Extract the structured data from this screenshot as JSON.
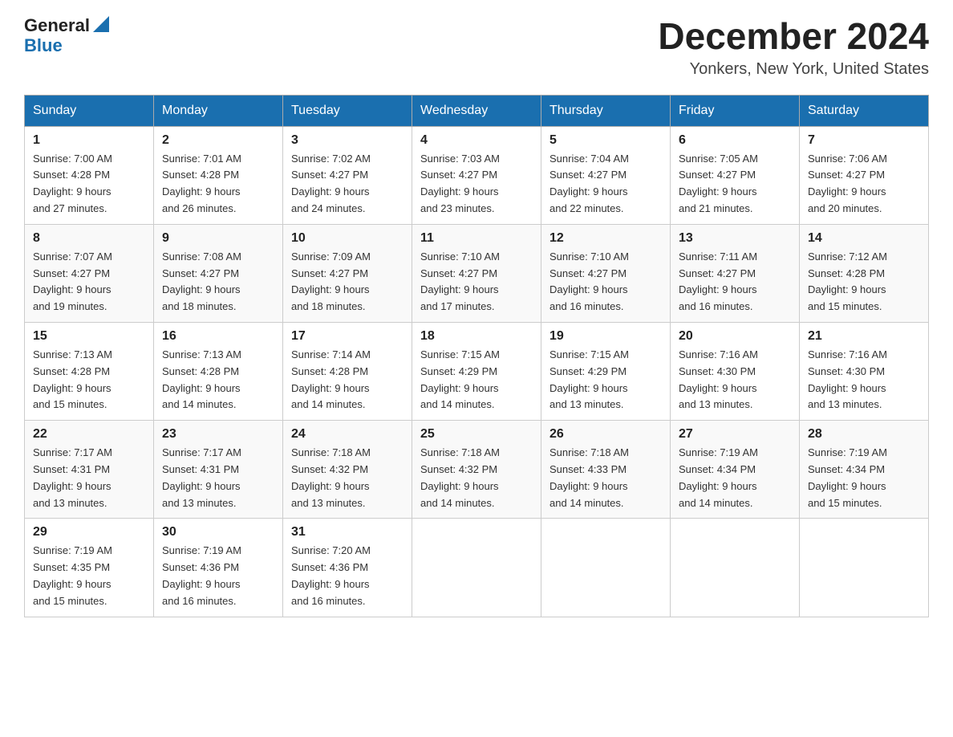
{
  "logo": {
    "general": "General",
    "blue": "Blue"
  },
  "title": "December 2024",
  "location": "Yonkers, New York, United States",
  "days_of_week": [
    "Sunday",
    "Monday",
    "Tuesday",
    "Wednesday",
    "Thursday",
    "Friday",
    "Saturday"
  ],
  "weeks": [
    [
      {
        "day": "1",
        "sunrise": "7:00 AM",
        "sunset": "4:28 PM",
        "daylight": "9 hours and 27 minutes."
      },
      {
        "day": "2",
        "sunrise": "7:01 AM",
        "sunset": "4:28 PM",
        "daylight": "9 hours and 26 minutes."
      },
      {
        "day": "3",
        "sunrise": "7:02 AM",
        "sunset": "4:27 PM",
        "daylight": "9 hours and 24 minutes."
      },
      {
        "day": "4",
        "sunrise": "7:03 AM",
        "sunset": "4:27 PM",
        "daylight": "9 hours and 23 minutes."
      },
      {
        "day": "5",
        "sunrise": "7:04 AM",
        "sunset": "4:27 PM",
        "daylight": "9 hours and 22 minutes."
      },
      {
        "day": "6",
        "sunrise": "7:05 AM",
        "sunset": "4:27 PM",
        "daylight": "9 hours and 21 minutes."
      },
      {
        "day": "7",
        "sunrise": "7:06 AM",
        "sunset": "4:27 PM",
        "daylight": "9 hours and 20 minutes."
      }
    ],
    [
      {
        "day": "8",
        "sunrise": "7:07 AM",
        "sunset": "4:27 PM",
        "daylight": "9 hours and 19 minutes."
      },
      {
        "day": "9",
        "sunrise": "7:08 AM",
        "sunset": "4:27 PM",
        "daylight": "9 hours and 18 minutes."
      },
      {
        "day": "10",
        "sunrise": "7:09 AM",
        "sunset": "4:27 PM",
        "daylight": "9 hours and 18 minutes."
      },
      {
        "day": "11",
        "sunrise": "7:10 AM",
        "sunset": "4:27 PM",
        "daylight": "9 hours and 17 minutes."
      },
      {
        "day": "12",
        "sunrise": "7:10 AM",
        "sunset": "4:27 PM",
        "daylight": "9 hours and 16 minutes."
      },
      {
        "day": "13",
        "sunrise": "7:11 AM",
        "sunset": "4:27 PM",
        "daylight": "9 hours and 16 minutes."
      },
      {
        "day": "14",
        "sunrise": "7:12 AM",
        "sunset": "4:28 PM",
        "daylight": "9 hours and 15 minutes."
      }
    ],
    [
      {
        "day": "15",
        "sunrise": "7:13 AM",
        "sunset": "4:28 PM",
        "daylight": "9 hours and 15 minutes."
      },
      {
        "day": "16",
        "sunrise": "7:13 AM",
        "sunset": "4:28 PM",
        "daylight": "9 hours and 14 minutes."
      },
      {
        "day": "17",
        "sunrise": "7:14 AM",
        "sunset": "4:28 PM",
        "daylight": "9 hours and 14 minutes."
      },
      {
        "day": "18",
        "sunrise": "7:15 AM",
        "sunset": "4:29 PM",
        "daylight": "9 hours and 14 minutes."
      },
      {
        "day": "19",
        "sunrise": "7:15 AM",
        "sunset": "4:29 PM",
        "daylight": "9 hours and 13 minutes."
      },
      {
        "day": "20",
        "sunrise": "7:16 AM",
        "sunset": "4:30 PM",
        "daylight": "9 hours and 13 minutes."
      },
      {
        "day": "21",
        "sunrise": "7:16 AM",
        "sunset": "4:30 PM",
        "daylight": "9 hours and 13 minutes."
      }
    ],
    [
      {
        "day": "22",
        "sunrise": "7:17 AM",
        "sunset": "4:31 PM",
        "daylight": "9 hours and 13 minutes."
      },
      {
        "day": "23",
        "sunrise": "7:17 AM",
        "sunset": "4:31 PM",
        "daylight": "9 hours and 13 minutes."
      },
      {
        "day": "24",
        "sunrise": "7:18 AM",
        "sunset": "4:32 PM",
        "daylight": "9 hours and 13 minutes."
      },
      {
        "day": "25",
        "sunrise": "7:18 AM",
        "sunset": "4:32 PM",
        "daylight": "9 hours and 14 minutes."
      },
      {
        "day": "26",
        "sunrise": "7:18 AM",
        "sunset": "4:33 PM",
        "daylight": "9 hours and 14 minutes."
      },
      {
        "day": "27",
        "sunrise": "7:19 AM",
        "sunset": "4:34 PM",
        "daylight": "9 hours and 14 minutes."
      },
      {
        "day": "28",
        "sunrise": "7:19 AM",
        "sunset": "4:34 PM",
        "daylight": "9 hours and 15 minutes."
      }
    ],
    [
      {
        "day": "29",
        "sunrise": "7:19 AM",
        "sunset": "4:35 PM",
        "daylight": "9 hours and 15 minutes."
      },
      {
        "day": "30",
        "sunrise": "7:19 AM",
        "sunset": "4:36 PM",
        "daylight": "9 hours and 16 minutes."
      },
      {
        "day": "31",
        "sunrise": "7:20 AM",
        "sunset": "4:36 PM",
        "daylight": "9 hours and 16 minutes."
      },
      null,
      null,
      null,
      null
    ]
  ]
}
